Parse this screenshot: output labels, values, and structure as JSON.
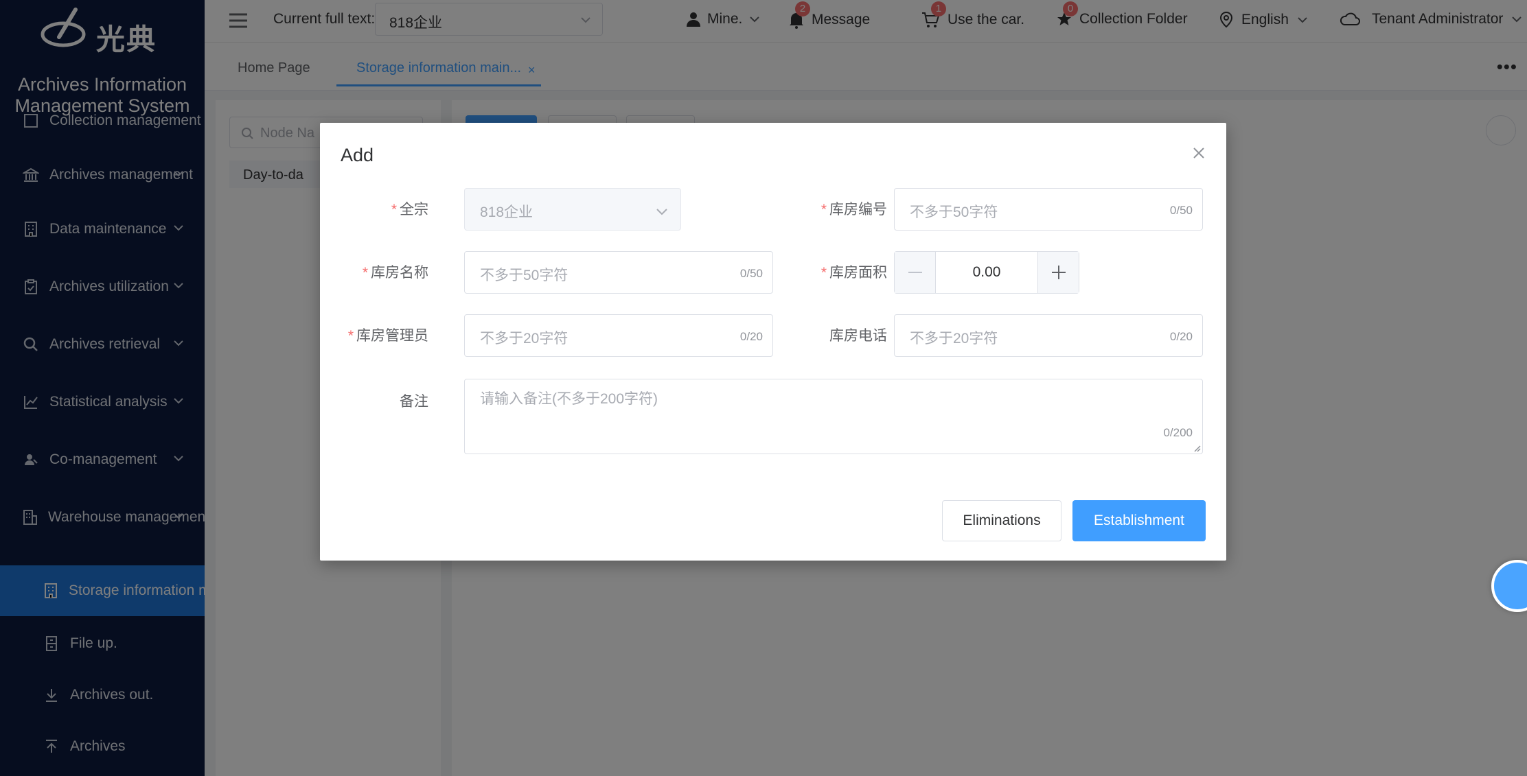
{
  "brand": {
    "logo_text": "光典",
    "system_title_line1": "Archives Information",
    "system_title_line2": "Management System"
  },
  "sidebar": {
    "items": [
      {
        "label": "Collection management",
        "icon": "box-icon"
      },
      {
        "label": "Archives management",
        "icon": "bank-icon"
      },
      {
        "label": "Data maintenance",
        "icon": "building-icon"
      },
      {
        "label": "Archives utilization",
        "icon": "clipboard-check-icon"
      },
      {
        "label": "Archives retrieval",
        "icon": "search-icon"
      },
      {
        "label": "Statistical analysis",
        "icon": "line-chart-icon"
      },
      {
        "label": "Co-management",
        "icon": "user-group-icon"
      },
      {
        "label": "Warehouse management",
        "icon": "warehouse-icon"
      }
    ],
    "subitems": [
      {
        "label": "Storage information maintenance",
        "icon": "building-icon",
        "active": true
      },
      {
        "label": "File up.",
        "icon": "file-cabinet-icon"
      },
      {
        "label": "Archives out.",
        "icon": "download-icon"
      },
      {
        "label": "Archives",
        "icon": "upload-icon"
      }
    ]
  },
  "topbar": {
    "current_full_text_label": "Current full text:",
    "current_full_text_value": "818企业",
    "mine": "Mine.",
    "message": "Message",
    "message_badge": "2",
    "car": "Use the car.",
    "car_badge": "1",
    "collection": "Collection Folder",
    "collection_badge": "0",
    "language": "English",
    "tenant": "Tenant Administrator"
  },
  "tabs": [
    {
      "label": "Home Page",
      "active": false
    },
    {
      "label": "Storage information main...",
      "active": true
    }
  ],
  "left_panel": {
    "search_placeholder": "Node Na",
    "tree_node": "Day-to-da"
  },
  "modal": {
    "title": "Add",
    "fields": {
      "fonds": {
        "label": "全宗",
        "value": "818企业",
        "required": true
      },
      "room_no": {
        "label": "库房编号",
        "placeholder": "不多于50字符",
        "count": "0/50",
        "required": true
      },
      "room_name": {
        "label": "库房名称",
        "placeholder": "不多于50字符",
        "count": "0/50",
        "required": true
      },
      "room_area": {
        "label": "库房面积",
        "value": "0.00",
        "required": true
      },
      "room_admin": {
        "label": "库房管理员",
        "placeholder": "不多于20字符",
        "count": "0/20",
        "required": true
      },
      "room_phone": {
        "label": "库房电话",
        "placeholder": "不多于20字符",
        "count": "0/20",
        "required": false
      },
      "remarks": {
        "label": "备注",
        "placeholder": "请输入备注(不多于200字符)",
        "count": "0/200",
        "required": false
      }
    },
    "cancel_label": "Eliminations",
    "submit_label": "Establishment"
  },
  "colors": {
    "sidebar_bg": "#0c1a3e",
    "accent": "#409eff",
    "active_menu": "#1e74d6",
    "required_mark": "#f56c6c"
  }
}
